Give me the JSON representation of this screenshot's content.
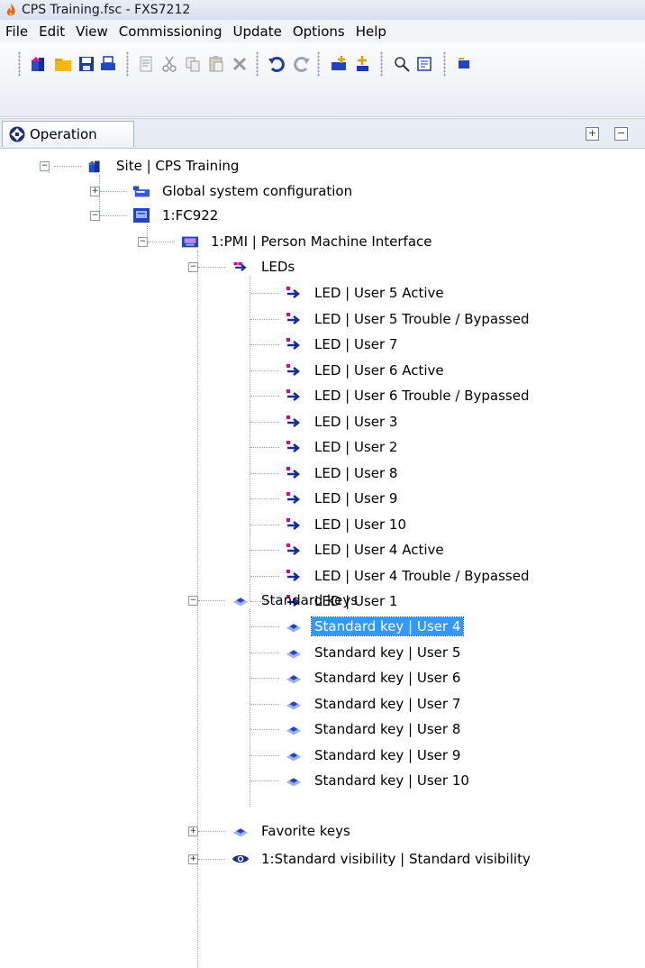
{
  "window": {
    "title": "CPS Training.fsc - FXS7212"
  },
  "menu": [
    "File",
    "Edit",
    "View",
    "Commissioning",
    "Update",
    "Options",
    "Help"
  ],
  "panel": {
    "tab_label": "Operation"
  },
  "tree": {
    "site": "Site | CPS Training",
    "global": "Global system configuration",
    "fc922": "1:FC922",
    "pmi": "1:PMI | Person Machine Interface",
    "leds_folder": "LEDs",
    "leds": [
      "LED | User 5 Active",
      "LED | User 5 Trouble / Bypassed",
      "LED | User 7",
      "LED | User 6 Active",
      "LED | User 6 Trouble / Bypassed",
      "LED | User 3",
      "LED | User 2",
      "LED | User 8",
      "LED | User 9",
      "LED | User 10",
      "LED | User 4 Active",
      "LED | User 4 Trouble / Bypassed",
      "LED | User 1"
    ],
    "keys_folder": "Standard keys",
    "keys": [
      "Standard key | User 4",
      "Standard key | User 5",
      "Standard key | User 6",
      "Standard key | User 7",
      "Standard key | User 8",
      "Standard key | User 9",
      "Standard key | User 10"
    ],
    "selected_key_index": 0,
    "favorite_keys": "Favorite keys",
    "visibility": "1:Standard visibility | Standard visibility"
  },
  "colors": {
    "selection": "#3399ff",
    "led_icon": "#cc00aa",
    "arrow_icon": "#1a2a9a"
  }
}
